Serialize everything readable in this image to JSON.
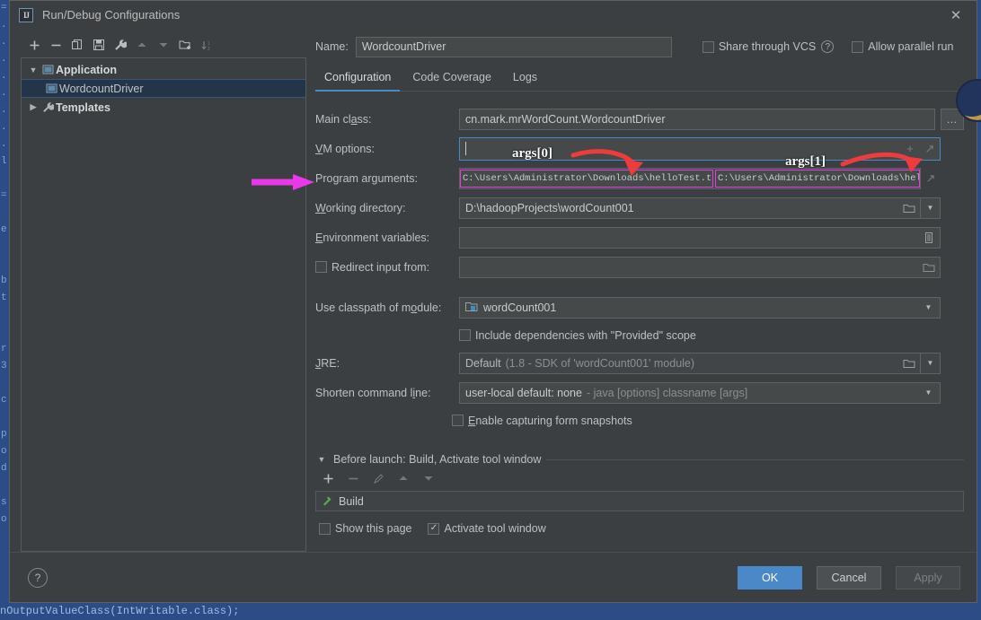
{
  "window": {
    "title": "Run/Debug Configurations",
    "app_icon": "IJ",
    "close_icon": "close-icon"
  },
  "left_panel": {
    "toolbar": [
      {
        "name": "add-configuration-button",
        "glyph": "+",
        "enabled": true
      },
      {
        "name": "remove-configuration-button",
        "glyph": "−",
        "enabled": true
      },
      {
        "name": "copy-configuration-button",
        "glyph": "copy-icon",
        "enabled": true
      },
      {
        "name": "save-configuration-button",
        "glyph": "save-icon",
        "enabled": true
      },
      {
        "name": "edit-templates-button",
        "glyph": "wrench-icon",
        "enabled": true
      },
      {
        "name": "move-up-button",
        "glyph": "▲",
        "enabled": false
      },
      {
        "name": "move-down-button",
        "glyph": "▼",
        "enabled": false
      },
      {
        "name": "new-folder-button",
        "glyph": "folder-plus-icon",
        "enabled": true
      },
      {
        "name": "sort-configurations-button",
        "glyph": "sort-icon",
        "enabled": false
      }
    ],
    "tree": [
      {
        "label": "Application",
        "type": "group",
        "expanded": true,
        "icon": "application-icon"
      },
      {
        "label": "WordcountDriver",
        "type": "item",
        "selected": true,
        "icon": "application-icon"
      },
      {
        "label": "Templates",
        "type": "group",
        "expanded": false,
        "icon": "wrench-icon"
      }
    ]
  },
  "name_row": {
    "label": "Name:",
    "value": "WordcountDriver",
    "share_vcs_label": "Share through VCS",
    "share_vcs_checked": false,
    "share_vcs_help": "?",
    "allow_parallel_label": "Allow parallel run",
    "allow_parallel_checked": false
  },
  "tabs": [
    {
      "label": "Configuration",
      "active": true
    },
    {
      "label": "Code Coverage",
      "active": false
    },
    {
      "label": "Logs",
      "active": false
    }
  ],
  "form": {
    "main_class": {
      "label": "Main class:",
      "value": "cn.mark.mrWordCount.WordcountDriver",
      "browse_label": "…"
    },
    "vm_options": {
      "label": "VM options:",
      "value": "",
      "expand_icon": "expand-icon",
      "add-macro_icon": "plus-icon"
    },
    "program_arguments": {
      "label": "Program arguments:",
      "arg0": "C:\\Users\\Administrator\\Downloads\\helloTest.txt",
      "arg1": "C:\\Users\\Administrator\\Downloads\\hel",
      "expand_icon": "expand-icon"
    },
    "working_directory": {
      "label": "Working directory:",
      "value": "D:\\hadoopProjects\\wordCount001",
      "browse_icon": "folder-icon",
      "dropdown_icon": "chevron-down-icon"
    },
    "environment_variables": {
      "label": "Environment variables:",
      "value": "",
      "browse_icon": "list-icon"
    },
    "redirect_input": {
      "label": "Redirect input from:",
      "checked": false,
      "value": "",
      "browse_icon": "folder-icon"
    },
    "classpath_module": {
      "label": "Use classpath of module:",
      "value": "wordCount001",
      "module_icon": "module-icon",
      "dropdown_icon": "chevron-down-icon"
    },
    "include_provided": {
      "label": "Include dependencies with \"Provided\" scope",
      "checked": false
    },
    "jre": {
      "label": "JRE:",
      "value": "Default",
      "hint": "(1.8 - SDK of 'wordCount001' module)",
      "browse_icon": "folder-icon",
      "dropdown_icon": "chevron-down-icon"
    },
    "shorten_command_line": {
      "label": "Shorten command line:",
      "value": "user-local default: none",
      "hint": "- java [options] classname [args]",
      "dropdown_icon": "chevron-down-icon"
    },
    "enable_snapshots": {
      "label": "Enable capturing form snapshots",
      "checked": false
    }
  },
  "before_launch": {
    "title": "Before launch: Build, Activate tool window",
    "collapse_icon": "chevron-down-icon",
    "toolbar": [
      {
        "name": "add-task-button",
        "glyph": "+",
        "enabled": true
      },
      {
        "name": "remove-task-button",
        "glyph": "−",
        "enabled": false
      },
      {
        "name": "edit-task-button",
        "glyph": "pencil-icon",
        "enabled": false
      },
      {
        "name": "move-task-up-button",
        "glyph": "▲",
        "enabled": false
      },
      {
        "name": "move-task-down-button",
        "glyph": "▼",
        "enabled": false
      }
    ],
    "tasks": [
      {
        "label": "Build",
        "icon": "build-hammer-icon"
      }
    ],
    "show_this_page": {
      "label": "Show this page",
      "checked": false
    },
    "activate_tool_window": {
      "label": "Activate tool window",
      "checked": true
    }
  },
  "footer": {
    "help_label": "?",
    "ok_label": "OK",
    "cancel_label": "Cancel",
    "apply_label": "Apply",
    "apply_disabled": true
  },
  "annotations": [
    {
      "text": "args[0]",
      "color": "#ff2d2d"
    },
    {
      "text": "args[1]",
      "color": "#ff2d2d"
    }
  ],
  "background": {
    "bottom_code": "nOutputValueClass(IntWritable.class);",
    "side_glyphs": "=\n.\n.\n.\n.\n.\n.\n.\n.\nl\n\n=\n\ne\n\n\nb\nt\n\n\nr\n3\n\nc\n\np\no\nd\n\ns\no"
  },
  "colors": {
    "accent": "#4a88c7",
    "annotation_red": "#ff2d2d",
    "annotation_magenta": "#e838e8",
    "dialog_bg": "#3c3f41",
    "field_bg": "#45494a"
  }
}
